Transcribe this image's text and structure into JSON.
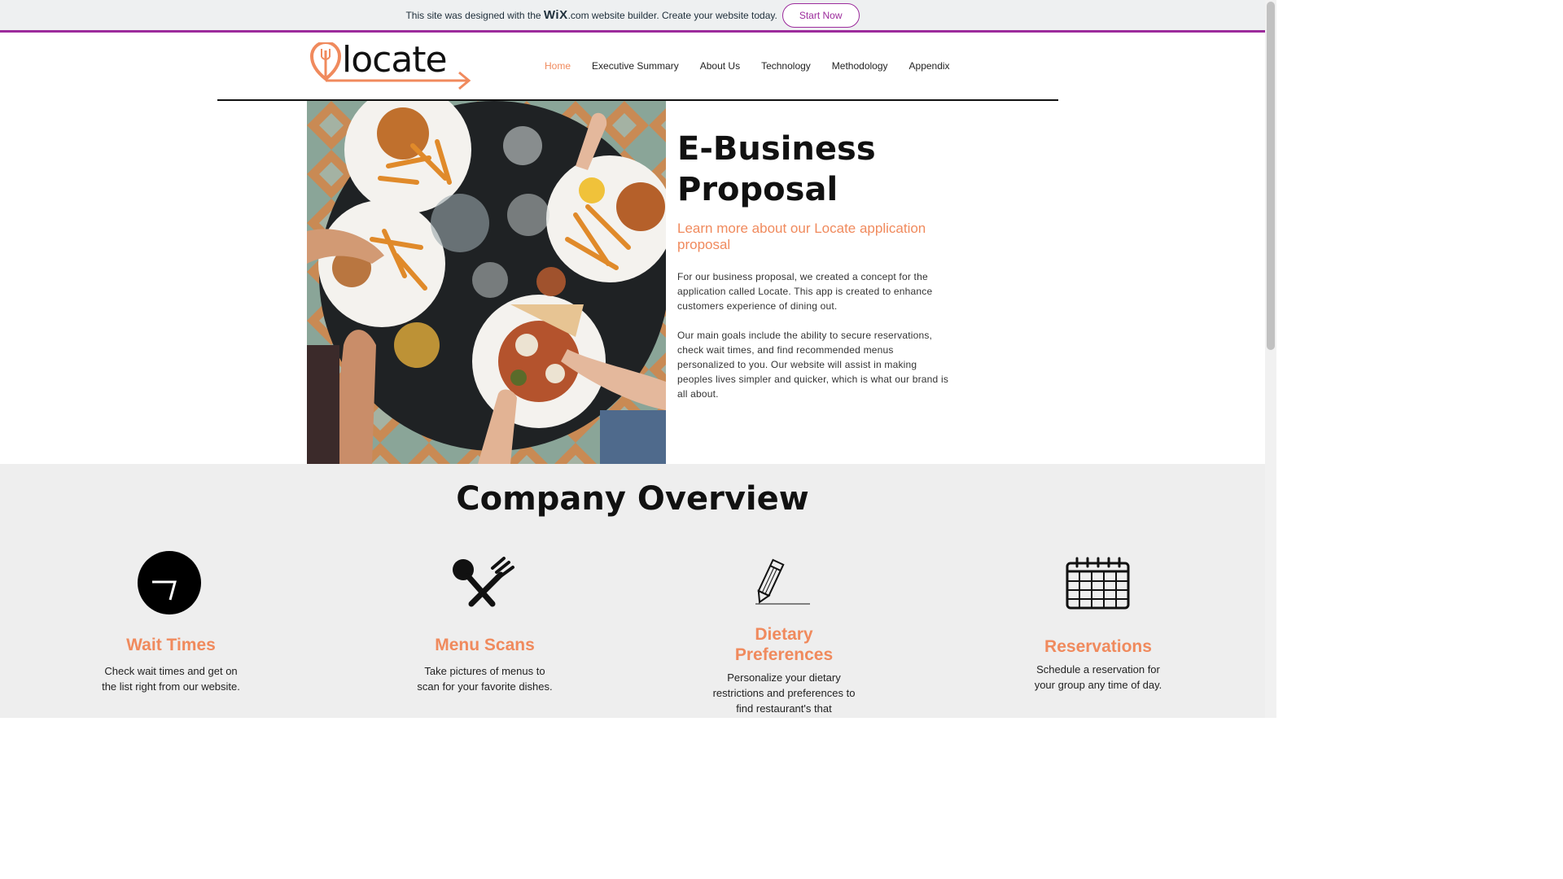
{
  "banner": {
    "prefix": "This site was designed with the",
    "brand": "WiX",
    "suffix": ".com website builder. Create your website today.",
    "button": "Start Now"
  },
  "logo": {
    "text": "locate"
  },
  "nav": [
    {
      "label": "Home",
      "active": true
    },
    {
      "label": "Executive Summary",
      "active": false
    },
    {
      "label": "About Us",
      "active": false
    },
    {
      "label": "Technology",
      "active": false
    },
    {
      "label": "Methodology",
      "active": false
    },
    {
      "label": "Appendix",
      "active": false
    }
  ],
  "hero": {
    "title_line1": "E-Business",
    "title_line2": "Proposal",
    "subtitle": "Learn more about our Locate application proposal",
    "para1": "For our business proposal, we created a concept for the application called Locate. This app is created to enhance customers experience of dining out.",
    "para2": "Our main goals include the ability to secure reservations, check wait times, and find recommended menus personalized to you. Our website will assist in making peoples lives simpler and quicker, which is what our brand is all about."
  },
  "overview": {
    "title": "Company Overview",
    "features": [
      {
        "icon": "clock-icon",
        "title": "Wait Times",
        "desc": "Check wait times and get on the list right from our website."
      },
      {
        "icon": "utensils-icon",
        "title": "Menu Scans",
        "desc": "Take pictures of menus to scan for your favorite dishes."
      },
      {
        "icon": "pencil-icon",
        "title": "Dietary Preferences",
        "desc": "Personalize your dietary restrictions and preferences to find restaurant's that"
      },
      {
        "icon": "calendar-icon",
        "title": "Reservations",
        "desc": "Schedule a reservation for your group any time of day."
      }
    ]
  },
  "colors": {
    "accent": "#f08a5d",
    "wix_purple": "#9c2b9c",
    "section_bg": "#eeeeee"
  }
}
